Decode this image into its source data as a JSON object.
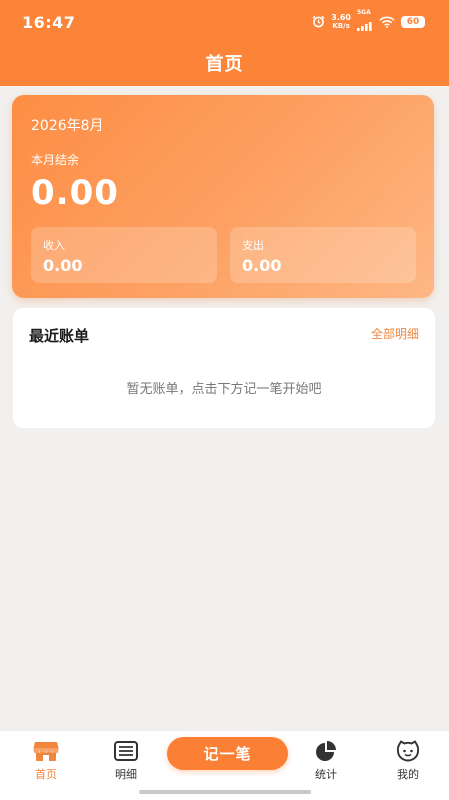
{
  "status_bar": {
    "time": "16:47",
    "net_speed_value": "3.60",
    "net_speed_unit": "KB/s",
    "network_type": "5GA",
    "battery_level": "60",
    "icons": [
      "alarm-icon",
      "signal-icon",
      "wifi-icon",
      "battery-icon"
    ]
  },
  "header": {
    "title": "首页"
  },
  "summary": {
    "month": "2026年8月",
    "balance_label": "本月结余",
    "balance_value": "0.00",
    "income_label": "收入",
    "income_value": "0.00",
    "expense_label": "支出",
    "expense_value": "0.00"
  },
  "recent": {
    "title": "最近账单",
    "view_all_label": "全部明细",
    "empty_text": "暂无账单，点击下方记一笔开始吧"
  },
  "tab_bar": {
    "home_label": "首页",
    "detail_label": "明细",
    "record_label": "记一笔",
    "stats_label": "统计",
    "mine_label": "我的",
    "active_tab": "home"
  },
  "colors": {
    "accent": "#fb8438",
    "page_background": "#f1f0ee",
    "link": "#f0863c"
  }
}
